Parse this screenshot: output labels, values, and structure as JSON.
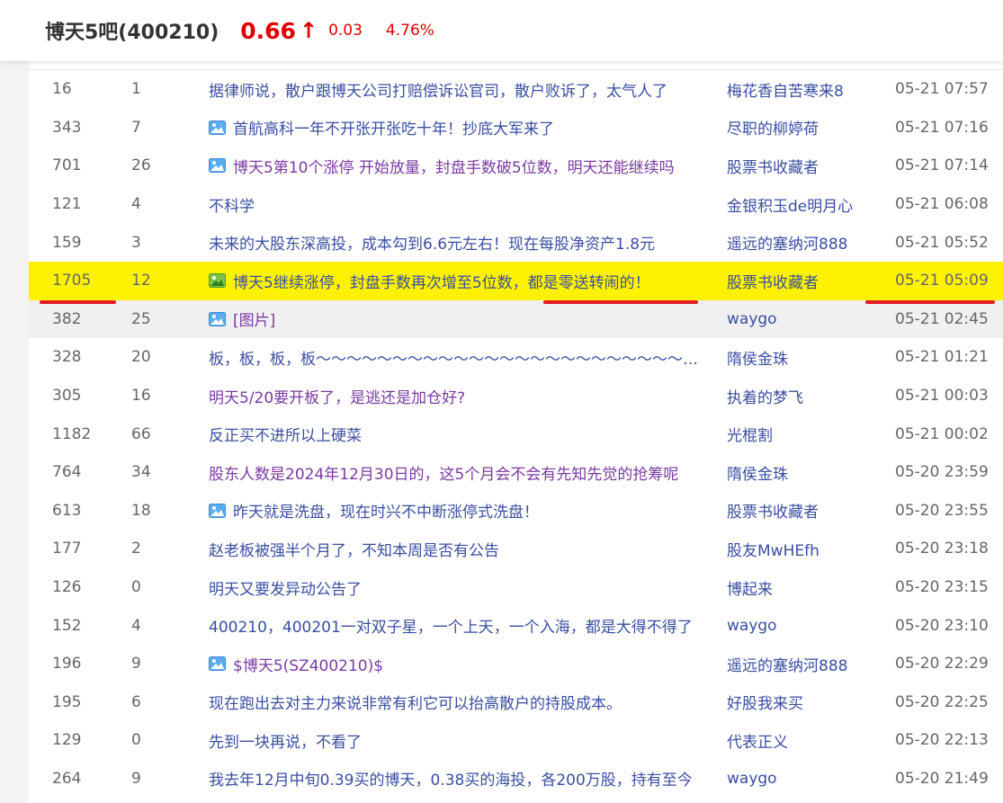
{
  "header": {
    "stock_name": "博天5吧(400210)",
    "price": "0.66",
    "arrow": "↑",
    "change": "0.03",
    "pct": "4.76%"
  },
  "colors": {
    "up": "#e10000",
    "link": "#3a4ea0",
    "visited": "#7a3aa0",
    "highlight": "#fff200",
    "underline": "#e31b23"
  },
  "rows": [
    {
      "read": "16",
      "reply": "1",
      "title": "据律师说，散户跟博天公司打赔偿诉讼官司，散户败诉了，太气人了",
      "author": "梅花香自苦寒来8",
      "time": "05-21 07:57",
      "icon": false,
      "visited": false
    },
    {
      "read": "343",
      "reply": "7",
      "title": "首航高科一年不开张开张吃十年！抄底大军来了",
      "author": "尽职的柳婷荷",
      "time": "05-21 07:16",
      "icon": true,
      "visited": false
    },
    {
      "read": "701",
      "reply": "26",
      "title": "博天5第10个涨停 开始放量，封盘手数破5位数，明天还能继续吗",
      "author": "股票书收藏者",
      "time": "05-21 07:14",
      "icon": true,
      "visited": true
    },
    {
      "read": "121",
      "reply": "4",
      "title": "不科学",
      "author": "金银积玉de明月心",
      "time": "05-21 06:08",
      "icon": false,
      "visited": false
    },
    {
      "read": "159",
      "reply": "3",
      "title": "未来的大股东深高投，成本勾到6.6元左右！现在每股净资产1.8元",
      "author": "遥远的塞纳河888",
      "time": "05-21 05:52",
      "icon": false,
      "visited": false
    },
    {
      "read": "1705",
      "reply": "12",
      "title": "博天5继续涨停，封盘手数再次增至5位数，都是零送转闹的！",
      "author": "股票书收藏者",
      "time": "05-21 05:09",
      "icon": true,
      "visited": false,
      "highlight": true
    },
    {
      "read": "382",
      "reply": "25",
      "title": "[图片]",
      "author": "waygo",
      "time": "05-21 02:45",
      "icon": true,
      "visited": true,
      "hover": true
    },
    {
      "read": "328",
      "reply": "20",
      "title": "板，板，板，板～～～～～～～～～～～～～～～～～～～～～～～～～～～～～～",
      "author": "隋侯金珠",
      "time": "05-21 01:21",
      "icon": false,
      "visited": false
    },
    {
      "read": "305",
      "reply": "16",
      "title": "明天5/20要开板了，是逃还是加仓好?",
      "author": "执着的梦飞",
      "time": "05-21 00:03",
      "icon": false,
      "visited": true
    },
    {
      "read": "1182",
      "reply": "66",
      "title": "反正买不进所以上硬菜",
      "author": "光棍割",
      "time": "05-21 00:02",
      "icon": false,
      "visited": false
    },
    {
      "read": "764",
      "reply": "34",
      "title": "股东人数是2024年12月30日的，这5个月会不会有先知先觉的抢筹呢",
      "author": "隋侯金珠",
      "time": "05-20 23:59",
      "icon": false,
      "visited": true
    },
    {
      "read": "613",
      "reply": "18",
      "title": "昨天就是洗盘，现在时兴不中断涨停式洗盘！",
      "author": "股票书收藏者",
      "time": "05-20 23:55",
      "icon": true,
      "visited": false
    },
    {
      "read": "177",
      "reply": "2",
      "title": "赵老板被强半个月了，不知本周是否有公告",
      "author": "股友MwHEfh",
      "time": "05-20 23:18",
      "icon": false,
      "visited": false
    },
    {
      "read": "126",
      "reply": "0",
      "title": "明天又要发异动公告了",
      "author": "博起来",
      "time": "05-20 23:15",
      "icon": false,
      "visited": false
    },
    {
      "read": "152",
      "reply": "4",
      "title": "400210，400201一对双子星，一个上天，一个入海，都是大得不得了",
      "author": "waygo",
      "time": "05-20 23:10",
      "icon": false,
      "visited": false
    },
    {
      "read": "196",
      "reply": "9",
      "title": "$博天5(SZ400210)$",
      "author": "遥远的塞纳河888",
      "time": "05-20 22:29",
      "icon": true,
      "visited": true
    },
    {
      "read": "195",
      "reply": "6",
      "title": "现在跑出去对主力来说非常有利它可以抬高散户的持股成本。",
      "author": "好股我来买",
      "time": "05-20 22:25",
      "icon": false,
      "visited": false
    },
    {
      "read": "129",
      "reply": "0",
      "title": "先到一块再说，不看了",
      "author": "代表正义",
      "time": "05-20 22:13",
      "icon": false,
      "visited": false
    },
    {
      "read": "264",
      "reply": "9",
      "title": "我去年12月中旬0.39买的博天，0.38买的海投，各200万股，持有至今",
      "author": "waygo",
      "time": "05-20 21:49",
      "icon": false,
      "visited": false
    }
  ]
}
